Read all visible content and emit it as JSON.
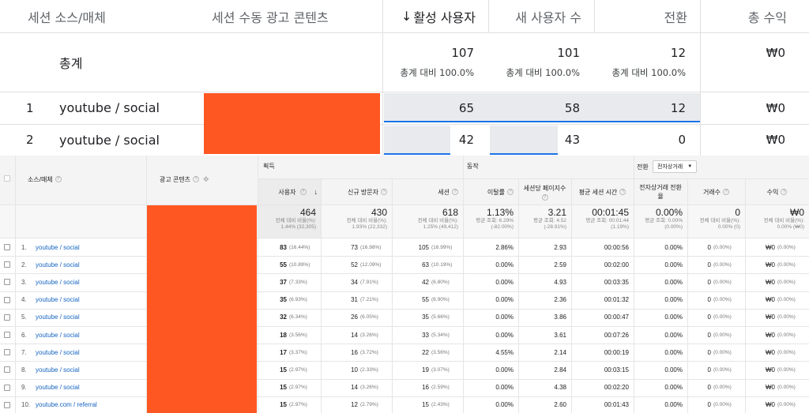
{
  "ga4": {
    "headers": {
      "source_medium": "세션 소스/매체",
      "manual_ad": "세션 수동 광고 콘텐츠",
      "active_users": "활성 사용자",
      "sort_arrow": "↓",
      "new_users": "새 사용자 수",
      "conversions": "전환",
      "revenue": "총 수익"
    },
    "totals": {
      "label": "총계",
      "active_users": "107",
      "active_users_sub": "총계 대비 100.0%",
      "new_users": "101",
      "new_users_sub": "총계 대비 100.0%",
      "conversions": "12",
      "conversions_sub": "총계 대비 100.0%",
      "revenue": "₩0"
    },
    "rows": [
      {
        "index": "1",
        "source": "youtube / social",
        "active_users": "65",
        "new_users": "58",
        "conversions": "12",
        "revenue": "₩0"
      },
      {
        "index": "2",
        "source": "youtube / social",
        "active_users": "42",
        "new_users": "43",
        "conversions": "0",
        "revenue": "₩0"
      }
    ]
  },
  "ua": {
    "headers": {
      "source_medium": "소스/매체",
      "ad_content": "광고 콘텐츠",
      "acquisition": "획득",
      "behavior": "동작",
      "conversion": "전환",
      "conversion_select": "전자상거래",
      "users": "사용자",
      "new_visitors": "신규 방문자",
      "sessions": "세션",
      "bounce_rate": "이탈률",
      "pages_per_session": "세션당 페이지수",
      "avg_session_time": "평균 세션 시간",
      "ecommerce_rate": "전자상거래 전환율",
      "transactions": "거래수",
      "revenue": "수익"
    },
    "totals": {
      "users": "464",
      "users_sub1": "전체 대비 비율(%):",
      "users_sub2": "1.44% (32,305)",
      "new_visitors": "430",
      "new_visitors_sub1": "전체 대비 비율(%):",
      "new_visitors_sub2": "1.93% (22,332)",
      "sessions": "618",
      "sessions_sub1": "전체 대비 비율(%):",
      "sessions_sub2": "1.25% (49,412)",
      "bounce_rate": "1.13%",
      "bounce_rate_sub1": "평균 조회: 6.29%",
      "bounce_rate_sub2": "(-82.00%)",
      "pages_per_session": "3.21",
      "pages_per_session_sub1": "평균 조회: 4.52",
      "pages_per_session_sub2": "(-28.91%)",
      "avg_session_time": "00:01:45",
      "avg_session_time_sub1": "평균 조회: 00:01:44",
      "avg_session_time_sub2": "(1.19%)",
      "ecommerce_rate": "0.00%",
      "ecommerce_rate_sub1": "평균 조회: 0.00%",
      "ecommerce_rate_sub2": "(0.00%)",
      "transactions": "0",
      "transactions_sub1": "전체 대비 비율(%):",
      "transactions_sub2": "0.00% (0)",
      "revenue": "₩0",
      "revenue_sub1": "전체 대비 비율(%):",
      "revenue_sub2": "0.00% (₩0)"
    },
    "rows": [
      {
        "index": "1.",
        "source": "youtube / social",
        "users": "83",
        "users_pct": "(16.44%)",
        "new": "73",
        "new_pct": "(16.98%)",
        "sessions": "105",
        "sessions_pct": "(16.99%)",
        "bounce": "2.86%",
        "pps": "2.93",
        "time": "00:00:56",
        "ecom": "0.00%",
        "tx": "0",
        "tx_pct": "(0.00%)",
        "rev": "₩0",
        "rev_pct": "(0.00%)"
      },
      {
        "index": "2.",
        "source": "youtube / social",
        "users": "55",
        "users_pct": "(10.89%)",
        "new": "52",
        "new_pct": "(12.09%)",
        "sessions": "63",
        "sessions_pct": "(10.19%)",
        "bounce": "0.00%",
        "pps": "2.59",
        "time": "00:02:00",
        "ecom": "0.00%",
        "tx": "0",
        "tx_pct": "(0.00%)",
        "rev": "₩0",
        "rev_pct": "(0.00%)"
      },
      {
        "index": "3.",
        "source": "youtube / social",
        "users": "37",
        "users_pct": "(7.33%)",
        "new": "34",
        "new_pct": "(7.91%)",
        "sessions": "42",
        "sessions_pct": "(6.80%)",
        "bounce": "0.00%",
        "pps": "4.93",
        "time": "00:03:35",
        "ecom": "0.00%",
        "tx": "0",
        "tx_pct": "(0.00%)",
        "rev": "₩0",
        "rev_pct": "(0.00%)"
      },
      {
        "index": "4.",
        "source": "youtube / social",
        "users": "35",
        "users_pct": "(6.93%)",
        "new": "31",
        "new_pct": "(7.21%)",
        "sessions": "55",
        "sessions_pct": "(8.90%)",
        "bounce": "0.00%",
        "pps": "2.36",
        "time": "00:01:32",
        "ecom": "0.00%",
        "tx": "0",
        "tx_pct": "(0.00%)",
        "rev": "₩0",
        "rev_pct": "(0.00%)"
      },
      {
        "index": "5.",
        "source": "youtube / social",
        "users": "32",
        "users_pct": "(6.34%)",
        "new": "26",
        "new_pct": "(6.05%)",
        "sessions": "35",
        "sessions_pct": "(5.66%)",
        "bounce": "0.00%",
        "pps": "3.86",
        "time": "00:00:47",
        "ecom": "0.00%",
        "tx": "0",
        "tx_pct": "(0.00%)",
        "rev": "₩0",
        "rev_pct": "(0.00%)"
      },
      {
        "index": "6.",
        "source": "youtube / social",
        "users": "18",
        "users_pct": "(3.56%)",
        "new": "14",
        "new_pct": "(3.26%)",
        "sessions": "33",
        "sessions_pct": "(5.34%)",
        "bounce": "0.00%",
        "pps": "3.61",
        "time": "00:07:26",
        "ecom": "0.00%",
        "tx": "0",
        "tx_pct": "(0.00%)",
        "rev": "₩0",
        "rev_pct": "(0.00%)"
      },
      {
        "index": "7.",
        "source": "youtube / social",
        "users": "17",
        "users_pct": "(3.37%)",
        "new": "16",
        "new_pct": "(3.72%)",
        "sessions": "22",
        "sessions_pct": "(3.56%)",
        "bounce": "4.55%",
        "pps": "2.14",
        "time": "00:00:19",
        "ecom": "0.00%",
        "tx": "0",
        "tx_pct": "(0.00%)",
        "rev": "₩0",
        "rev_pct": "(0.00%)"
      },
      {
        "index": "8.",
        "source": "youtube / social",
        "users": "15",
        "users_pct": "(2.97%)",
        "new": "10",
        "new_pct": "(2.33%)",
        "sessions": "19",
        "sessions_pct": "(3.07%)",
        "bounce": "0.00%",
        "pps": "2.84",
        "time": "00:03:15",
        "ecom": "0.00%",
        "tx": "0",
        "tx_pct": "(0.00%)",
        "rev": "₩0",
        "rev_pct": "(0.00%)"
      },
      {
        "index": "9.",
        "source": "youtube / social",
        "users": "15",
        "users_pct": "(2.97%)",
        "new": "14",
        "new_pct": "(3.26%)",
        "sessions": "16",
        "sessions_pct": "(2.59%)",
        "bounce": "0.00%",
        "pps": "4.38",
        "time": "00:02:20",
        "ecom": "0.00%",
        "tx": "0",
        "tx_pct": "(0.00%)",
        "rev": "₩0",
        "rev_pct": "(0.00%)"
      },
      {
        "index": "10.",
        "source": "youtube.com / referral",
        "users": "15",
        "users_pct": "(2.97%)",
        "new": "12",
        "new_pct": "(2.79%)",
        "sessions": "15",
        "sessions_pct": "(2.43%)",
        "bounce": "0.00%",
        "pps": "2.60",
        "time": "00:01:43",
        "ecom": "0.00%",
        "tx": "0",
        "tx_pct": "(0.00%)",
        "rev": "₩0",
        "rev_pct": "(0.00%)"
      }
    ]
  }
}
